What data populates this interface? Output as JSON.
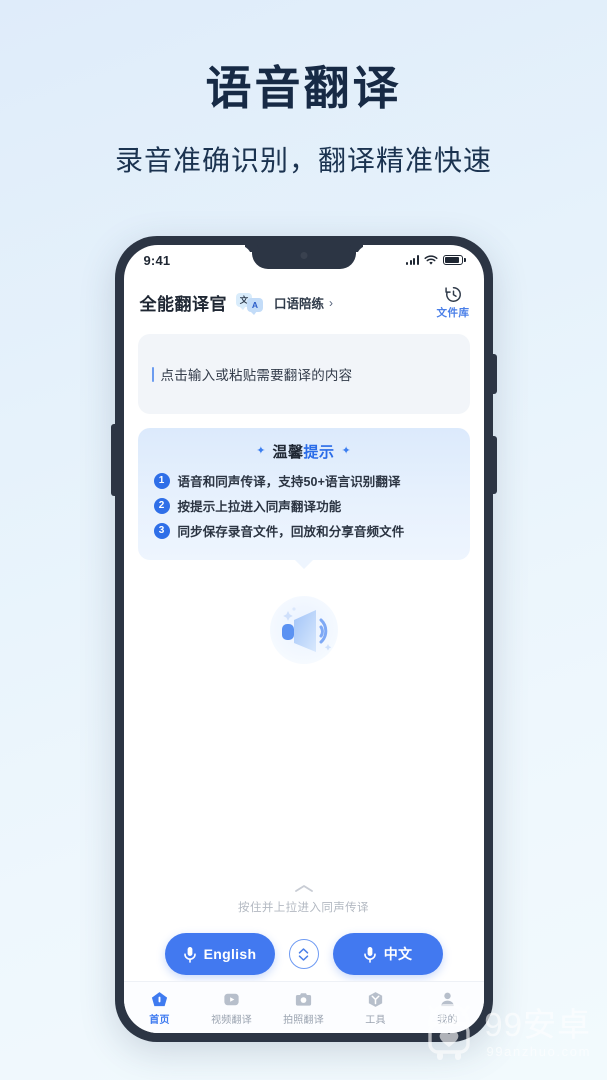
{
  "promo": {
    "title": "语音翻译",
    "subtitle": "录音准确识别，翻译精准快速"
  },
  "phone": {
    "status": {
      "time": "9:41",
      "signal_icon": "signal-bars-icon",
      "wifi_icon": "wifi-icon",
      "battery_icon": "battery-full-icon"
    },
    "header": {
      "app_title": "全能翻译官",
      "badge_first": "文",
      "badge_second": "A",
      "chip_label": "口语陪练",
      "chip_arrow": "›",
      "file_library_label": "文件库",
      "file_library_icon": "history-clock-icon"
    },
    "input": {
      "placeholder": "点击输入或粘贴需要翻译的内容"
    },
    "tips": {
      "sparkle": "✦",
      "title_dark": "温馨",
      "title_blue": "提示",
      "items": [
        {
          "num": "1",
          "text": "语音和同声传译，支持50+语言识别翻译"
        },
        {
          "num": "2",
          "text": "按提示上拉进入同声翻译功能"
        },
        {
          "num": "3",
          "text": "同步保存录音文件，回放和分享音频文件"
        }
      ]
    },
    "illustration": {
      "icon": "speaker-sound-icon"
    },
    "pull_hint": {
      "chevron_icon": "chevron-up-icon",
      "text": "按住并上拉进入同声传译"
    },
    "mic_buttons": {
      "left_label": "English",
      "right_label": "中文",
      "mic_icon": "microphone-icon",
      "swap_icon": "swap-vertical-icon"
    },
    "bottom_nav": [
      {
        "label": "首页",
        "icon": "home-icon",
        "active": true
      },
      {
        "label": "视频翻译",
        "icon": "video-icon",
        "active": false
      },
      {
        "label": "拍照翻译",
        "icon": "camera-icon",
        "active": false
      },
      {
        "label": "工具",
        "icon": "toolbox-icon",
        "active": false
      },
      {
        "label": "我的",
        "icon": "person-icon",
        "active": false
      }
    ]
  },
  "watermark": {
    "robot_icon": "android-robot-icon",
    "main": "99安卓",
    "sub": "99anzhuo.com"
  },
  "colors": {
    "accent_blue": "#4279f0",
    "title_navy": "#172a45",
    "nav_inactive": "#9aa3b0",
    "frame": "#2c3544"
  }
}
